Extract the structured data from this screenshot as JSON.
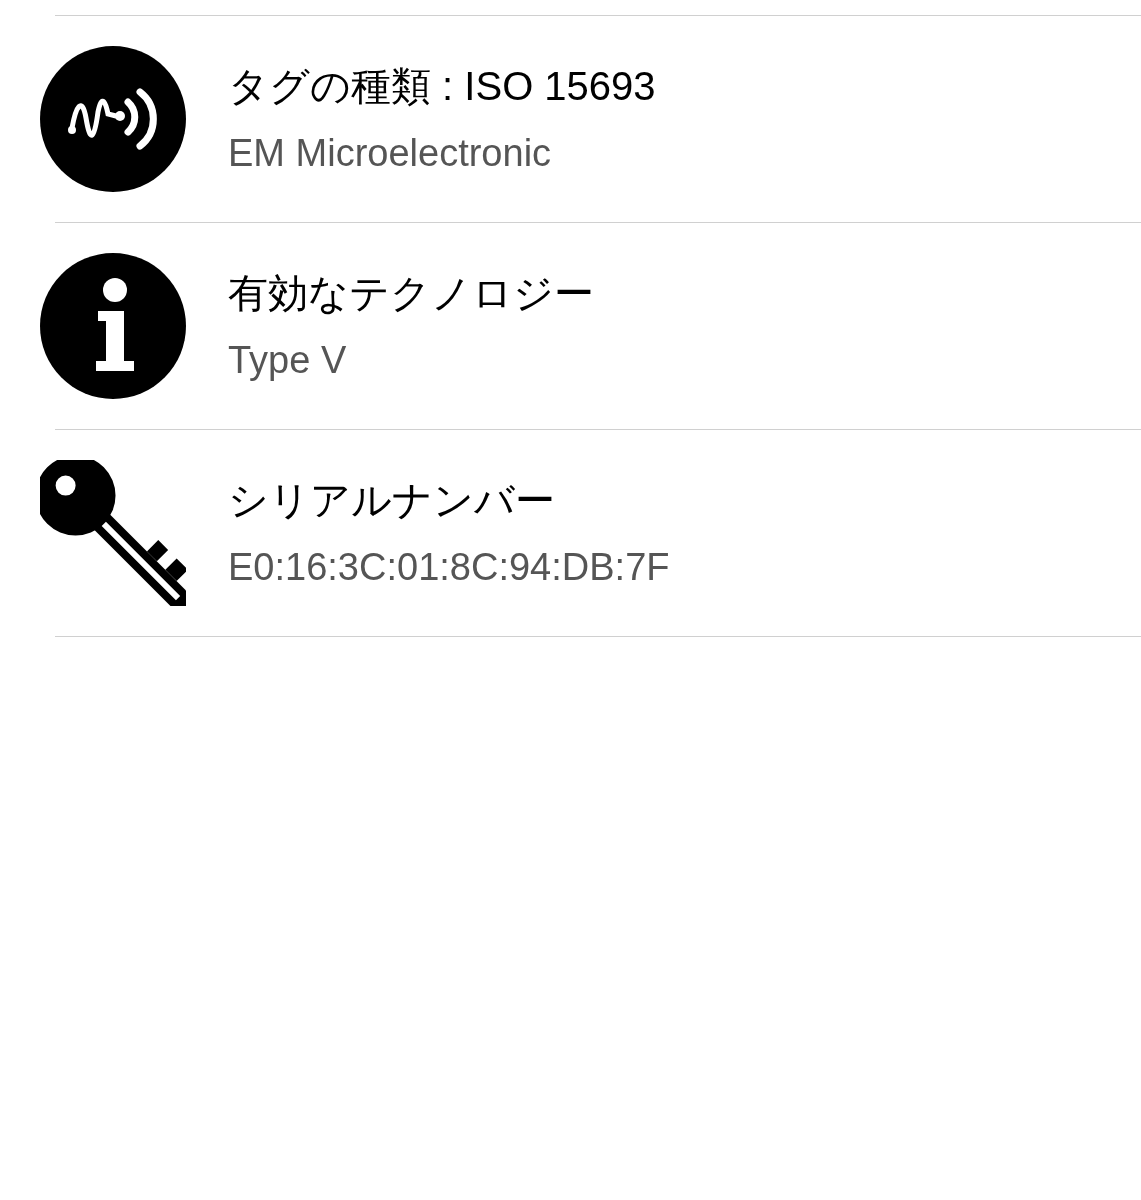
{
  "items": [
    {
      "kind": "tag",
      "title": "タグの種類 : ISO 15693",
      "subtitle": "EM Microelectronic"
    },
    {
      "kind": "info",
      "title": "有効なテクノロジー",
      "subtitle": "Type V"
    },
    {
      "kind": "key",
      "title": "シリアルナンバー",
      "subtitle": "E0:16:3C:01:8C:94:DB:7F"
    }
  ]
}
